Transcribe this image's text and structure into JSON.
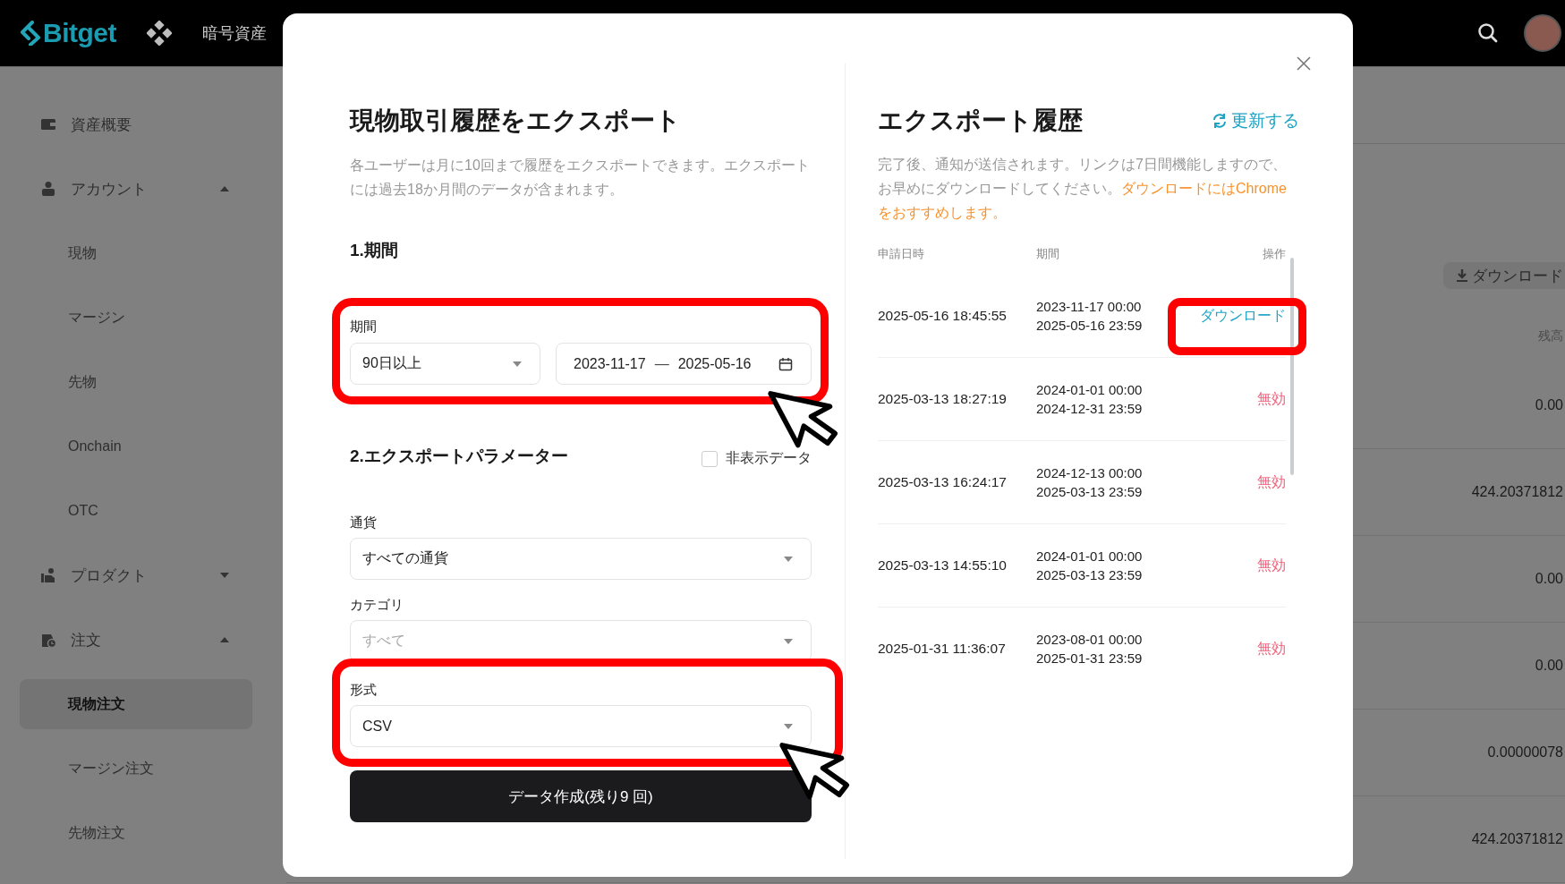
{
  "header": {
    "logo": "Bitget",
    "nav_item": "暗号資産"
  },
  "sidebar": {
    "items": [
      {
        "label": "資産概要",
        "selected": false
      },
      {
        "label": "アカウント",
        "selected": false,
        "expanded": true,
        "children": [
          {
            "label": "現物",
            "selected": false
          },
          {
            "label": "マージン",
            "selected": false
          },
          {
            "label": "先物",
            "selected": false
          },
          {
            "label": "Onchain",
            "selected": false
          },
          {
            "label": "OTC",
            "selected": false
          }
        ]
      },
      {
        "label": "プロダクト",
        "selected": false,
        "expanded": false
      },
      {
        "label": "注文",
        "selected": false,
        "expanded": true,
        "children": [
          {
            "label": "現物注文",
            "selected": true
          },
          {
            "label": "マージン注文",
            "selected": false
          },
          {
            "label": "先物注文",
            "selected": false
          }
        ]
      }
    ]
  },
  "background": {
    "download_button": "ダウンロード",
    "column_header": "残高",
    "values": [
      "0.00",
      "424.20371812",
      "0.00",
      "0.00",
      "0.00000078",
      "424.20371812"
    ]
  },
  "export": {
    "title": "現物取引履歴をエクスポート",
    "description": "各ユーザーは月に10回まで履歴をエクスポートできます。エクスポートには過去18か月間のデータが含まれます。",
    "period_section": "1.期間",
    "period_label": "期間",
    "period_select": "90日以上",
    "date_from": "2023-11-17",
    "date_separator": "—",
    "date_to": "2025-05-16",
    "params_section": "2.エクスポートパラメーター",
    "hidden_data": {
      "label": "非表示データ",
      "checked": false
    },
    "fields": [
      {
        "label": "通貨",
        "value": "すべての通貨"
      },
      {
        "label": "カテゴリ",
        "placeholder": "すべて"
      },
      {
        "label": "形式",
        "value": "CSV"
      }
    ],
    "submit": "データ作成(残り9 回)"
  },
  "history": {
    "title": "エクスポート履歴",
    "refresh": "更新する",
    "notice": "完了後、通知が送信されます。リンクは7日間機能しますので、お早めにダウンロードしてください。",
    "notice_highlight": "ダウンロードにはChromeをおすすめします。",
    "columns": [
      "申請日時",
      "期間",
      "操作"
    ],
    "rows": [
      {
        "requested": "2025-05-16 18:45:55",
        "period_start": "2023-11-17 00:00",
        "period_end": "2025-05-16 23:59",
        "action": {
          "kind": "link",
          "text": "ダウンロード"
        }
      },
      {
        "requested": "2025-03-13 18:27:19",
        "period_start": "2024-01-01 00:00",
        "period_end": "2024-12-31 23:59",
        "action": {
          "kind": "status",
          "text": "無効"
        }
      },
      {
        "requested": "2025-03-13 16:24:17",
        "period_start": "2024-12-13 00:00",
        "period_end": "2025-03-13 23:59",
        "action": {
          "kind": "status",
          "text": "無効"
        }
      },
      {
        "requested": "2025-03-13 14:55:10",
        "period_start": "2024-01-01 00:00",
        "period_end": "2025-03-13 23:59",
        "action": {
          "kind": "status",
          "text": "無効"
        }
      },
      {
        "requested": "2025-01-31 11:36:07",
        "period_start": "2023-08-01 00:00",
        "period_end": "2025-01-31 23:59",
        "action": {
          "kind": "status",
          "text": "無効"
        }
      }
    ]
  }
}
